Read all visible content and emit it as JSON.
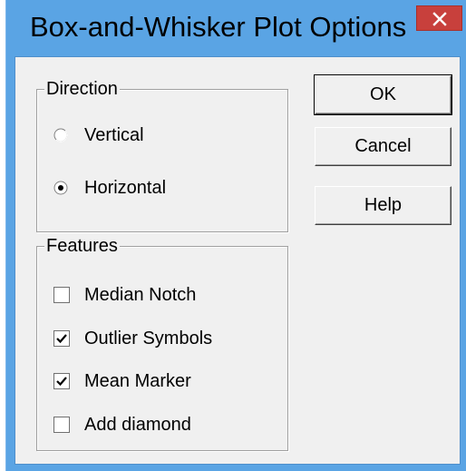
{
  "dialog": {
    "title": "Box-and-Whisker Plot Options",
    "close_label": "✕"
  },
  "direction": {
    "legend": "Direction",
    "options": [
      {
        "label": "Vertical",
        "selected": false
      },
      {
        "label": "Horizontal",
        "selected": true
      }
    ]
  },
  "features": {
    "legend": "Features",
    "options": [
      {
        "label": "Median Notch",
        "checked": false
      },
      {
        "label": "Outlier Symbols",
        "checked": true
      },
      {
        "label": "Mean Marker",
        "checked": true
      },
      {
        "label": "Add diamond",
        "checked": false
      }
    ]
  },
  "buttons": {
    "ok": "OK",
    "cancel": "Cancel",
    "help": "Help"
  },
  "colors": {
    "frame": "#5aa4e4",
    "close_button": "#c8403c",
    "client": "#f0f0f0"
  }
}
